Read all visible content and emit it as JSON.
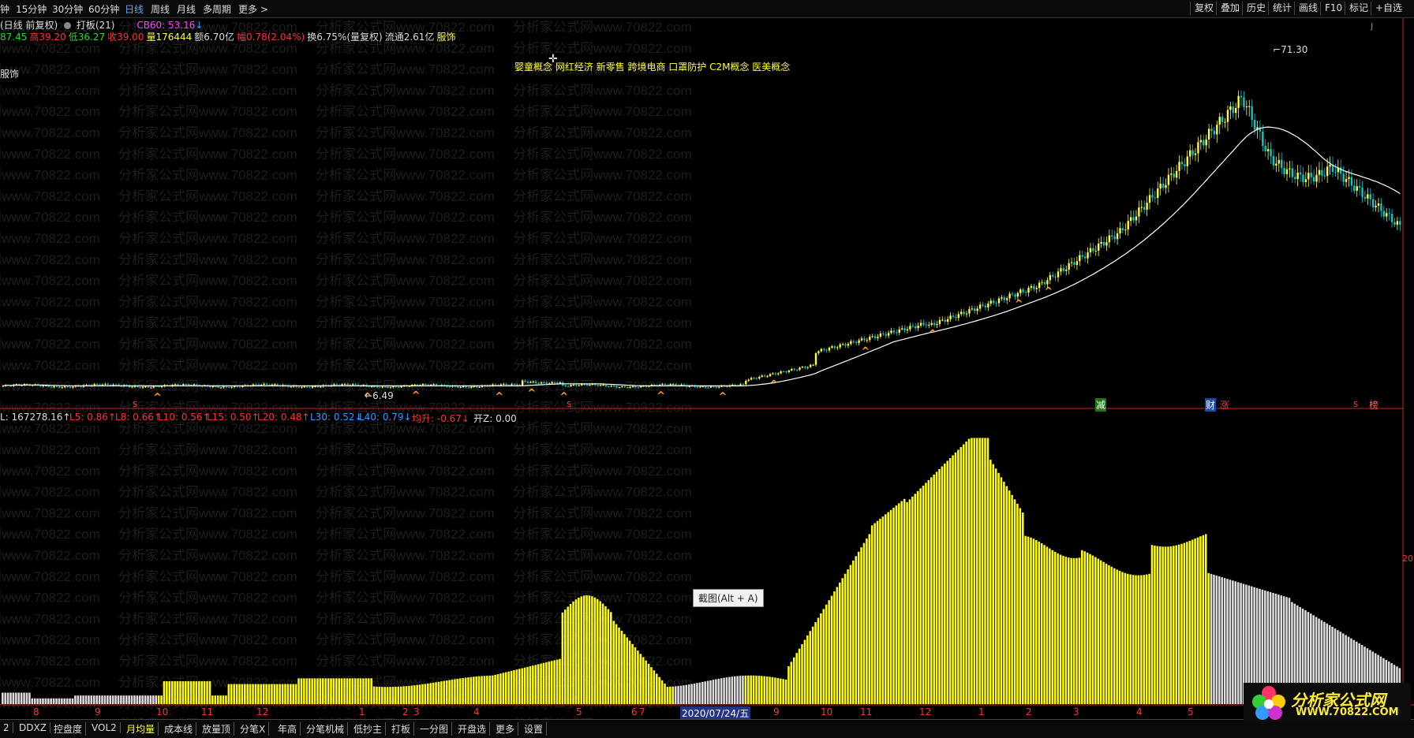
{
  "toolbar": {
    "periods": [
      "钟",
      "15分钟",
      "30分钟",
      "60分钟",
      "日线",
      "周线",
      "月线",
      "多周期",
      "更多 >"
    ],
    "active_period": "日线",
    "right_buttons": [
      "复权",
      "叠加",
      "历史",
      "统计",
      "画线",
      "F10",
      "标记",
      "+自选"
    ]
  },
  "info": {
    "title": "(日线 前复权)",
    "board_label": "打板(21)",
    "cb_label": "CB60: 53.16",
    "quote_parts": [
      {
        "text": "87.45",
        "color": "#22dd22"
      },
      {
        "text": "高39.20",
        "color": "#ff3333"
      },
      {
        "text": "低36.27",
        "color": "#22dd22"
      },
      {
        "text": "收39.00",
        "color": "#ff3333"
      },
      {
        "text": "量176444",
        "color": "#ffff33"
      },
      {
        "text": "额6.70亿",
        "color": "#dddddd"
      },
      {
        "text": "幅0.78(2.04%)",
        "color": "#ff3333"
      },
      {
        "text": "换6.75%(量复权)",
        "color": "#dddddd"
      },
      {
        "text": "流通2.61亿",
        "color": "#dddddd"
      },
      {
        "text": "服饰",
        "color": "#ffff33"
      }
    ],
    "sector_label": "服饰",
    "concepts": "婴童概念 网红经济 新零售 跨境电商 口罩防护 C2M概念 医美概念"
  },
  "price_panel": {
    "high_label": "71.30",
    "low_label": "6.49",
    "event_marks": [
      {
        "text": "s",
        "color": "#ff3333"
      },
      {
        "text": "s",
        "color": "#ff3333"
      },
      {
        "text": "减",
        "color": "#22cc22"
      },
      {
        "text": "财",
        "color": "#3399ff"
      },
      {
        "text": "涨",
        "color": "#ff3333"
      },
      {
        "text": "s",
        "color": "#ff3333"
      },
      {
        "text": "榜",
        "color": "#ff6633"
      }
    ]
  },
  "indicator_line": [
    {
      "text": "L: 167278.16↑",
      "color": "#dddddd"
    },
    {
      "text": "L5: 0.86↑",
      "color": "#ff3333"
    },
    {
      "text": "L8: 0.66↑",
      "color": "#ff3333"
    },
    {
      "text": "L10: 0.56↑",
      "color": "#ff3333"
    },
    {
      "text": "L15: 0.50↑",
      "color": "#ff3333"
    },
    {
      "text": "L20: 0.48↑",
      "color": "#ff3333"
    },
    {
      "text": "L30: 0.52↓",
      "color": "#3399ff"
    },
    {
      "text": "L40: 0.79↓",
      "color": "#3399ff"
    },
    {
      "text": "均升: -0.67↓",
      "color": "#ff3333"
    },
    {
      "text": "开Z: 0.00",
      "color": "#dddddd"
    }
  ],
  "tooltip": "截图(Alt + A)",
  "right_edge_label": "20",
  "date_axis": {
    "labels": [
      "8",
      "9",
      "10",
      "11",
      "12",
      "1",
      "2",
      "3",
      "4",
      "5",
      "6",
      "7",
      "2020/07/24/五",
      "9",
      "10",
      "11",
      "12",
      "1",
      "2",
      "3",
      "4",
      "5"
    ],
    "highlight": "2020/07/24/五"
  },
  "bottom_tabs": [
    "2",
    "DDXZ",
    "控盘度",
    "VOL2",
    "月均量",
    "成本线",
    "放量顶",
    "分笔X",
    "年高",
    "分笔机械",
    "低抄主",
    "打板",
    "一分图",
    "开盘选",
    "更多",
    "设置"
  ],
  "active_bottom_tab": "月均量",
  "watermark": "分析家公式网www.70822.com",
  "logo": {
    "title": "分析家公式网",
    "url": "WWW.70822.COM"
  },
  "colors": {
    "bg": "#000000",
    "up": "#ffff33",
    "down": "#00cccc",
    "ma": "#ffffff",
    "accent": "#ff3333",
    "volume": "#ffff00",
    "volume_tail": "#dddddd"
  }
}
